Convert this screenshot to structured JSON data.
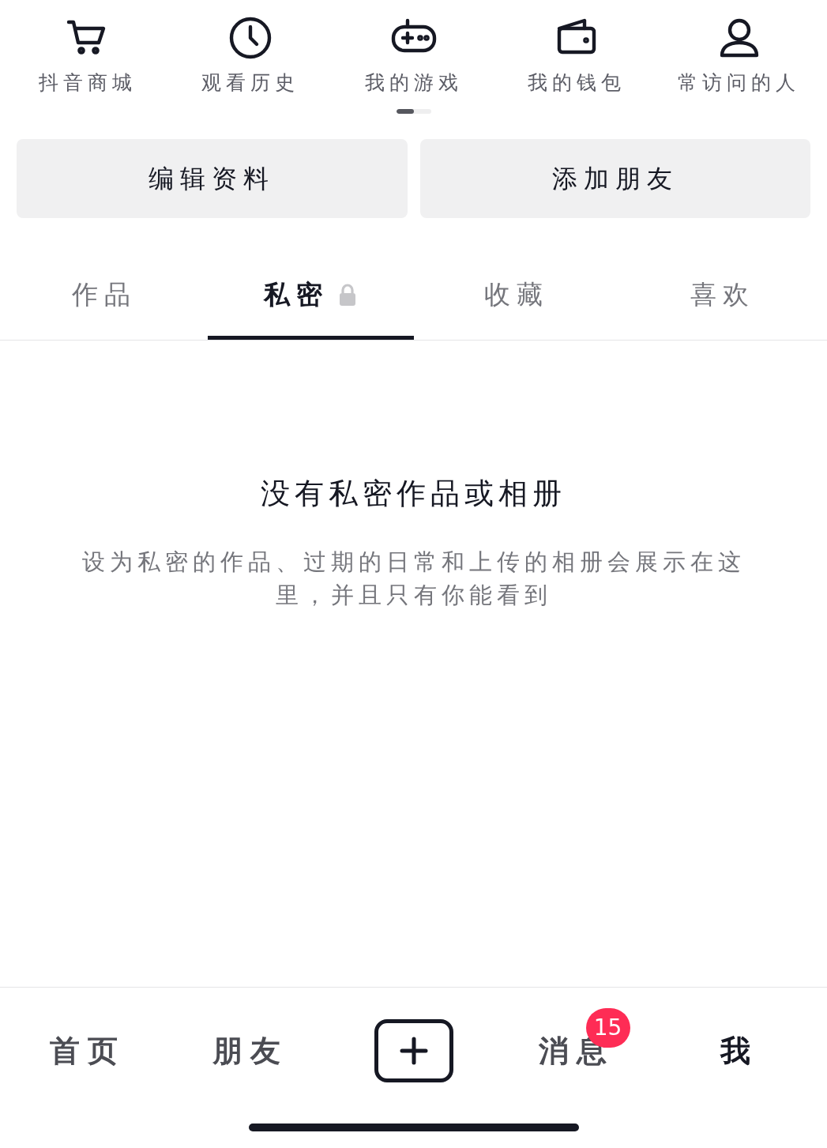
{
  "shortcuts": [
    {
      "label": "抖音商城",
      "kind": "cart"
    },
    {
      "label": "观看历史",
      "kind": "clock"
    },
    {
      "label": "我的游戏",
      "kind": "gamepad"
    },
    {
      "label": "我的钱包",
      "kind": "wallet"
    },
    {
      "label": "常访问的人",
      "kind": "person"
    }
  ],
  "pager": [
    {
      "selected": true
    },
    {
      "selected": false
    }
  ],
  "actions": [
    "编辑资料",
    "添加朋友"
  ],
  "tabs": [
    {
      "label": "作品",
      "selected": false,
      "locked": false
    },
    {
      "label": "私密",
      "selected": true,
      "locked": true
    },
    {
      "label": "收藏",
      "selected": false,
      "locked": false
    },
    {
      "label": "喜欢",
      "selected": false,
      "locked": false
    }
  ],
  "empty": {
    "title": "没有私密作品或相册",
    "description": "设为私密的作品、过期的日常和上传的相册会展示在这里，并且只有你能看到"
  },
  "nav": [
    {
      "kind": "label",
      "label": "首页",
      "selected": false
    },
    {
      "kind": "label",
      "label": "朋友",
      "selected": false
    },
    {
      "kind": "create"
    },
    {
      "kind": "label",
      "label": "消息",
      "selected": false,
      "badge": "15"
    },
    {
      "kind": "label",
      "label": "我",
      "selected": true
    }
  ]
}
